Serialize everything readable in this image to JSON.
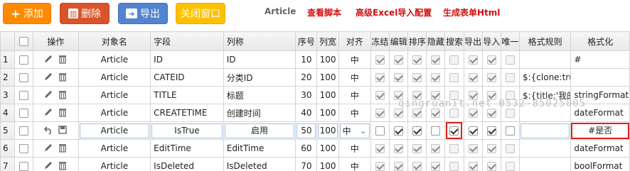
{
  "toolbar": {
    "add_label": "添加",
    "delete_label": "删除",
    "export_label": "导出",
    "close_label": "关闭窗口",
    "title": "Article",
    "links": [
      "查看脚本",
      "高级Excel导入配置",
      "生成表单Html"
    ]
  },
  "columns": [
    "操作",
    "对象名",
    "字段",
    "列称",
    "序号",
    "列宽",
    "对齐",
    "冻结",
    "编辑",
    "排序",
    "隐藏",
    "搜索",
    "导出",
    "导入",
    "唯一",
    "格式规则",
    "格式化"
  ],
  "rows": [
    {
      "no": "1",
      "obj": "Article",
      "field": "ID",
      "label": "ID",
      "seq": "10",
      "width": "100",
      "align": "中",
      "fmt_rule": "",
      "fmt": "#",
      "checks": [
        true,
        true,
        true,
        true,
        false,
        true,
        true,
        false
      ]
    },
    {
      "no": "2",
      "obj": "Article",
      "field": "CATEID",
      "label": "分类ID",
      "seq": "20",
      "width": "100",
      "align": "中",
      "fmt_rule": "$:{clone:true",
      "fmt": "",
      "checks": [
        true,
        true,
        true,
        true,
        false,
        true,
        true,
        false
      ]
    },
    {
      "no": "3",
      "obj": "Article",
      "field": "TITLE",
      "label": "标题",
      "seq": "30",
      "width": "100",
      "align": "中",
      "fmt_rule": "$:{title:'我的",
      "fmt": "stringFormat",
      "checks": [
        true,
        true,
        true,
        true,
        false,
        true,
        true,
        false
      ]
    },
    {
      "no": "4",
      "obj": "Article",
      "field": "CREATETIME",
      "label": "创建时间",
      "seq": "40",
      "width": "100",
      "align": "中",
      "fmt_rule": "",
      "fmt": "dateFormat",
      "checks": [
        true,
        true,
        true,
        true,
        false,
        true,
        true,
        false
      ]
    },
    {
      "no": "5",
      "obj": "Article",
      "field": "IsTrue",
      "label": "启用",
      "seq": "50",
      "width": "100",
      "align": "中",
      "fmt_rule": "",
      "fmt": "#是否",
      "checks": [
        false,
        true,
        true,
        false,
        true,
        true,
        true,
        false
      ]
    },
    {
      "no": "6",
      "obj": "Article",
      "field": "EditTime",
      "label": "EditTime",
      "seq": "60",
      "width": "100",
      "align": "中",
      "fmt_rule": "",
      "fmt": "dateFormat",
      "checks": [
        true,
        true,
        true,
        true,
        false,
        true,
        true,
        false
      ]
    },
    {
      "no": "7",
      "obj": "Article",
      "field": "IsDeleted",
      "label": "IsDeleted",
      "seq": "70",
      "width": "100",
      "align": "中",
      "fmt_rule": "",
      "fmt": "boolFormat",
      "checks": [
        true,
        true,
        true,
        true,
        false,
        true,
        true,
        false
      ]
    }
  ],
  "watermark": "qingruanit.net 0532-85025005",
  "colors": {
    "add": "#ff8a00",
    "delete": "#d9542a",
    "export": "#5384d0",
    "close": "#ffc000",
    "link": "#d01010",
    "highlight": "#e0211a"
  },
  "icons": {
    "add": "plus-icon",
    "delete": "trash-icon",
    "export": "export-icon",
    "edit": "pencil-icon",
    "remove": "trash-icon",
    "undo": "undo-icon",
    "save": "save-icon"
  }
}
